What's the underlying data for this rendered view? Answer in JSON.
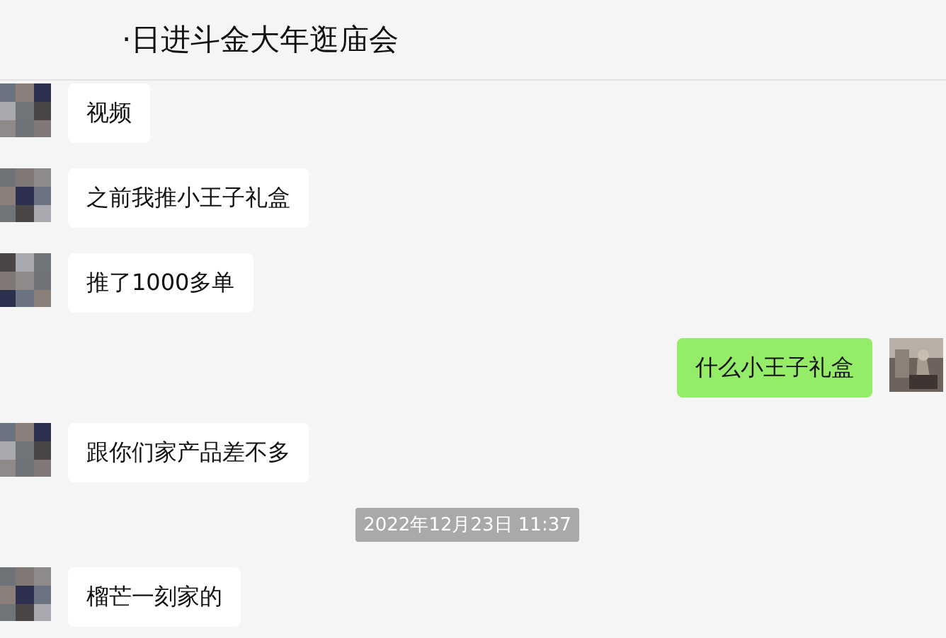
{
  "header": {
    "title": "·日进斗金大年逛庙会"
  },
  "messages": [
    {
      "kind": "incoming",
      "text": "视频"
    },
    {
      "kind": "incoming",
      "text": "之前我推小王子礼盒"
    },
    {
      "kind": "incoming",
      "text": "推了1000多单"
    },
    {
      "kind": "outgoing",
      "text": "什么小王子礼盒"
    },
    {
      "kind": "incoming",
      "text": "跟你们家产品差不多"
    },
    {
      "kind": "timestamp",
      "text": "2022年12月23日 11:37"
    },
    {
      "kind": "incoming",
      "text": "榴芒一刻家的"
    }
  ]
}
